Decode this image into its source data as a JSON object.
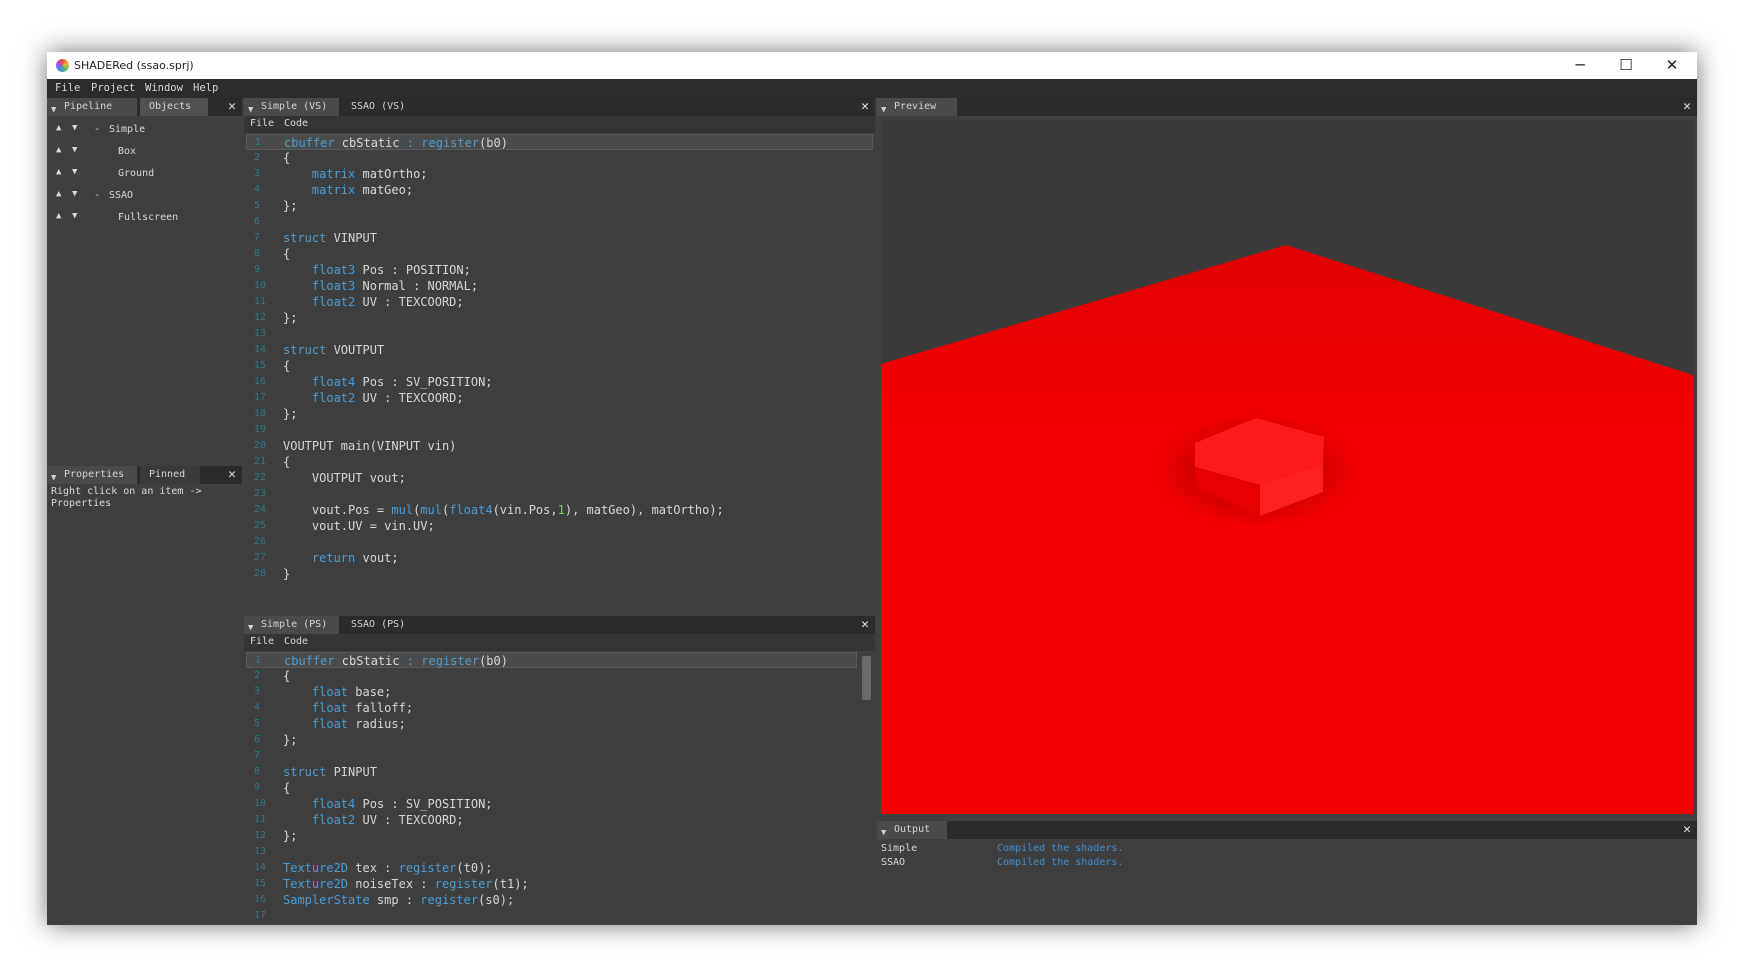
{
  "window": {
    "title": "SHADERed (ssao.sprj)",
    "controls": [
      "─",
      "☐",
      "✕"
    ]
  },
  "menu": [
    "File",
    "Project",
    "Window",
    "Help"
  ],
  "left_top": {
    "tabs": [
      "Pipeline",
      "Objects"
    ],
    "items": [
      {
        "up": "▲",
        "down": "▼",
        "prefix": "-",
        "label": "Simple"
      },
      {
        "up": "▲",
        "down": "▼",
        "prefix": "",
        "label": "Box"
      },
      {
        "up": "▲",
        "down": "▼",
        "prefix": "",
        "label": "Ground"
      },
      {
        "up": "▲",
        "down": "▼",
        "prefix": "-",
        "label": "SSAO"
      },
      {
        "up": "▲",
        "down": "▼",
        "prefix": "",
        "label": "Fullscreen"
      }
    ]
  },
  "left_bottom": {
    "tabs": [
      "Properties",
      "Pinned"
    ],
    "hint": "Right click on an item ->\nProperties"
  },
  "vs_editor": {
    "tabs": [
      "Simple (VS)",
      "SSAO (VS)"
    ],
    "menu": [
      "File",
      "Code"
    ],
    "lines": [
      "<span class=\"kw\">cbuffer</span> cbStatic <span class=\"kw\">: register</span>(b0)",
      "{",
      "    <span class=\"kw\">matrix</span> matOrtho;",
      "    <span class=\"kw\">matrix</span> matGeo;",
      "};",
      "",
      "<span class=\"kw\">struct</span> VINPUT",
      "{",
      "    <span class=\"kw\">float3</span> Pos : POSITION;",
      "    <span class=\"kw\">float3</span> Normal : NORMAL;",
      "    <span class=\"kw\">float2</span> UV : TEXCOORD;",
      "};",
      "",
      "<span class=\"kw\">struct</span> VOUTPUT",
      "{",
      "    <span class=\"kw\">float4</span> Pos : SV_POSITION;",
      "    <span class=\"kw\">float2</span> UV : TEXCOORD;",
      "};",
      "",
      "VOUTPUT main(VINPUT vin)",
      "{",
      "    VOUTPUT vout;",
      "",
      "    vout.Pos = <span class=\"kw\">mul</span>(<span class=\"kw\">mul</span>(<span class=\"kw\">float4</span>(vin.Pos,<span class=\"num\">1</span>), matGeo), matOrtho);",
      "    vout.UV = vin.UV;",
      "",
      "    <span class=\"kw\">return</span> vout;",
      "}"
    ]
  },
  "ps_editor": {
    "tabs": [
      "Simple (PS)",
      "SSAO (PS)"
    ],
    "menu": [
      "File",
      "Code"
    ],
    "lines": [
      "<span class=\"kw\">cbuffer</span> cbStatic <span class=\"kw\">: register</span>(b0)",
      "{",
      "    <span class=\"kw\">float</span> base;",
      "    <span class=\"kw\">float</span> falloff;",
      "    <span class=\"kw\">float</span> radius;",
      "};",
      "",
      "<span class=\"kw\">struct</span> PINPUT",
      "{",
      "    <span class=\"kw\">float4</span> Pos : SV_POSITION;",
      "    <span class=\"kw\">float2</span> UV : TEXCOORD;",
      "};",
      "",
      "<span class=\"kw\">Texture2D</span> tex : <span class=\"kw\">register</span>(t0);",
      "<span class=\"kw\">Texture2D</span> noiseTex : <span class=\"kw\">register</span>(t1);",
      "<span class=\"kw\">SamplerState</span> smp : <span class=\"kw\">register</span>(s0);",
      ""
    ]
  },
  "preview": {
    "tab": "Preview",
    "render_color": "#ff0000"
  },
  "output": {
    "tab": "Output",
    "rows": [
      {
        "name": "Simple",
        "message": "Compiled the shaders."
      },
      {
        "name": "SSAO",
        "message": "Compiled the shaders."
      }
    ]
  },
  "close_glyph": "✕",
  "tab_glyph": "▼"
}
